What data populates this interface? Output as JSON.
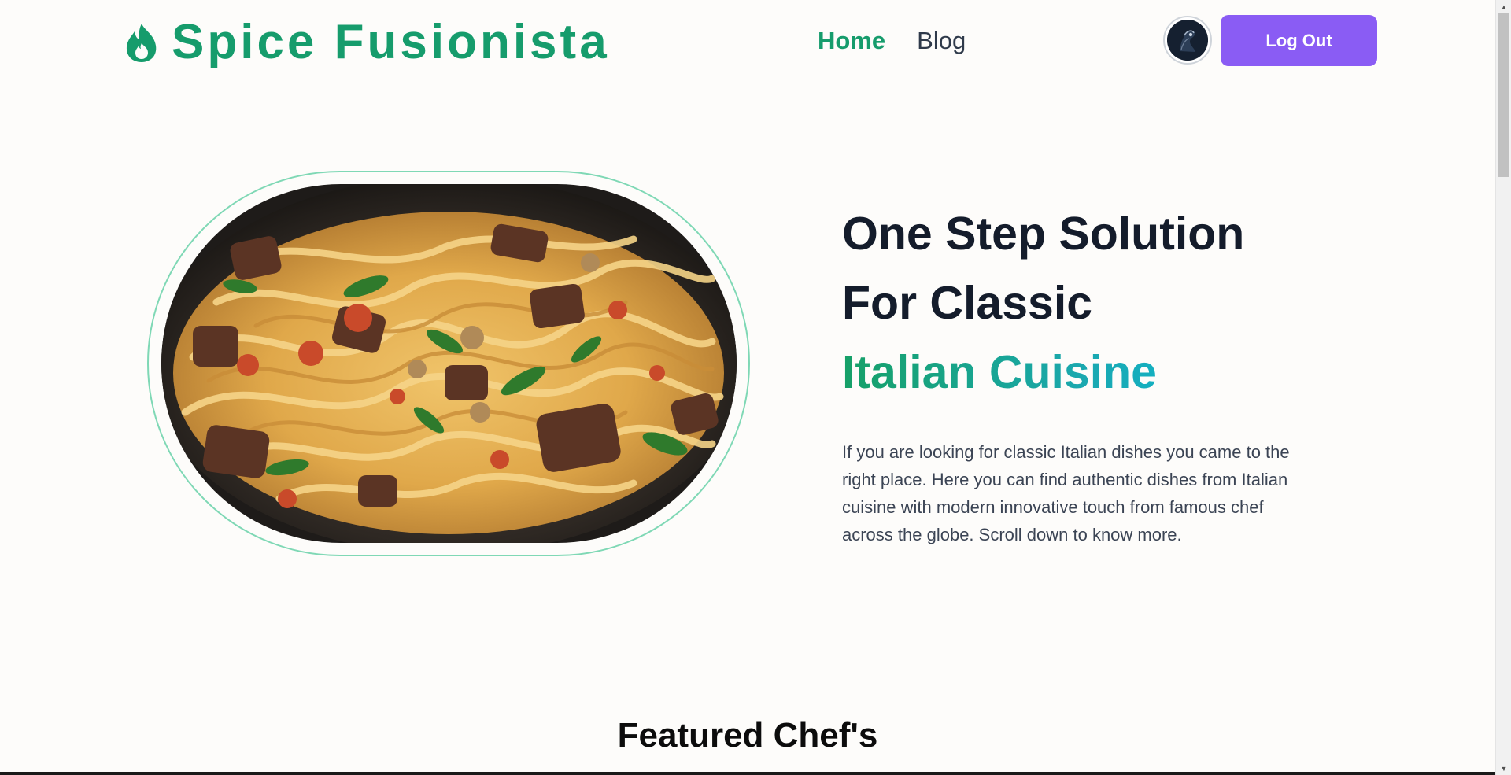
{
  "brand": {
    "name": "Spice Fusionista",
    "icon": "flame-icon",
    "color": "#169c6c"
  },
  "nav": {
    "links": [
      {
        "label": "Home",
        "active": true
      },
      {
        "label": "Blog",
        "active": false
      }
    ],
    "avatar_icon": "user-avatar",
    "logout_label": "Log Out",
    "logout_color": "#8a5cf4"
  },
  "hero": {
    "image_icon": "pasta-dish-image",
    "title_line1": "One Step Solution",
    "title_line2": "For Classic",
    "title_accent": "Italian Cuisine",
    "description": "If you are looking for classic Italian dishes you came to the right place. Here you can find authentic dishes from Italian cuisine with modern innovative touch from famous chef across the globe. Scroll down to know more."
  },
  "featured": {
    "title": "Featured Chef's"
  },
  "colors": {
    "background": "#fdfcfa",
    "heading": "#141c2b",
    "frame_border": "#7fd8b5",
    "accent_gradient": [
      "#16a067",
      "#12b2c6",
      "#22c08f"
    ]
  }
}
